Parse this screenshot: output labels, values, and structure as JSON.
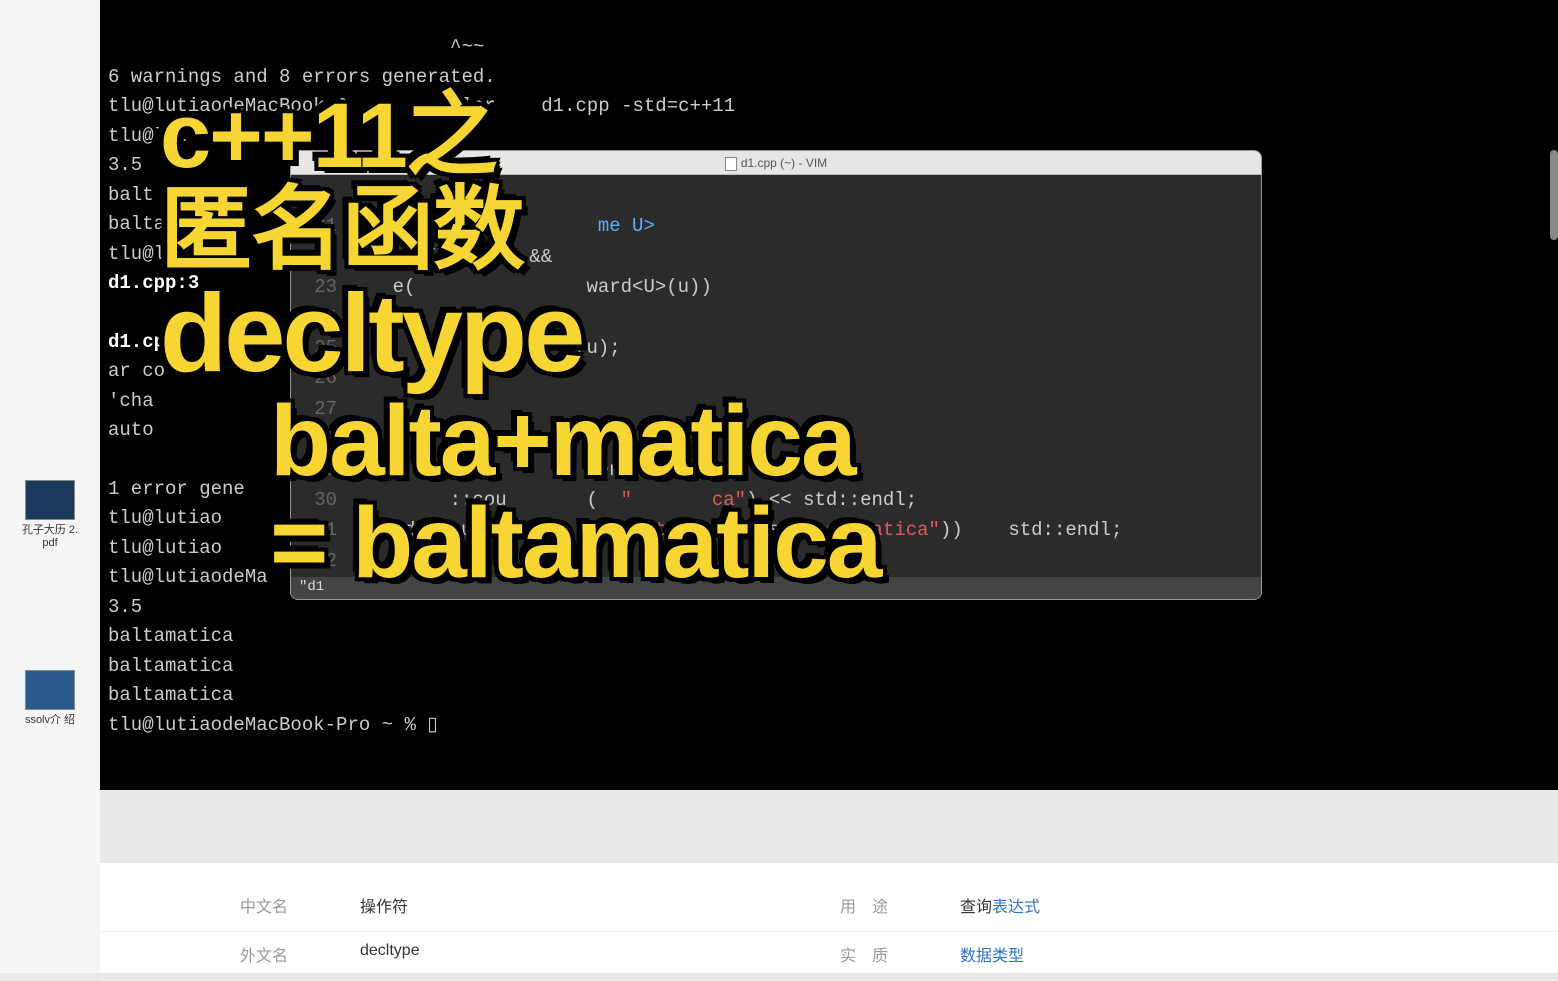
{
  "desktop_icons": [
    {
      "label": "孔子大历\n2.pdf"
    },
    {
      "label": "ssolv介\n绍"
    }
  ],
  "terminal": {
    "lines": [
      "                              ^~~",
      "6 warnings and 8 errors generated.",
      "tlu@lutiaodeMacBook-P         clar    d1.cpp -std=c++11",
      "tlu@lut",
      "3.5",
      "balt",
      "baltamatica",
      "tlu@lut",
      "d1.cpp:3",
      "",
      "d1.cpp:    6:",
      "ar co",
      "'cha",
      "auto",
      "",
      "1 error gene",
      "tlu@lutiao",
      "tlu@lutiao",
      "tlu@lutiaodeMa",
      "3.5",
      "baltamatica",
      "baltamatica",
      "baltamatica",
      "tlu@lutiaodeMacBook-Pro ~ % "
    ],
    "cursor": "▯"
  },
  "vim": {
    "title": "d1.cpp (~) - VIM",
    "lines": [
      {
        "n": 21,
        "t": "templ                 me U>"
      },
      {
        "n": 22,
        "t": "      d( T &&   &&"
      },
      {
        "n": 23,
        "t": "    e(               ward<U>(u))"
      },
      {
        "n": 24,
        "t": ""
      },
      {
        "n": 25,
        "t": "                   >(u);"
      },
      {
        "n": 26,
        "t": ""
      },
      {
        "n": 27,
        "t": ""
      },
      {
        "n": 28,
        "t": ""
      },
      {
        "n": 29,
        "t": "                      endl;"
      },
      {
        "n": 30,
        "t": "         ::cou       (  \"       ca\") << std::endl;"
      },
      {
        "n": 31,
        "t": "   std::cout <<      ( \"balta\", std::string(\"matica\"))    std::endl;"
      },
      {
        "n": 32,
        "t": "                                    \"m"
      },
      {
        "n": 33,
        "t": ""
      }
    ],
    "status": "\"d1"
  },
  "overlay": {
    "line1": "c++11之",
    "line2": "匿名函数",
    "line3": "decltype",
    "line4": "balta+matica",
    "line5": "= baltamatica"
  },
  "info": {
    "rows": [
      {
        "label1": "中文名",
        "value1": "操作符",
        "label2": "用　途",
        "value2_prefix": "查询",
        "value2_link": "表达式"
      },
      {
        "label1": "外文名",
        "value1": "decltype",
        "label2": "实　质",
        "value2_prefix": "",
        "value2_link": "数据类型"
      }
    ]
  }
}
